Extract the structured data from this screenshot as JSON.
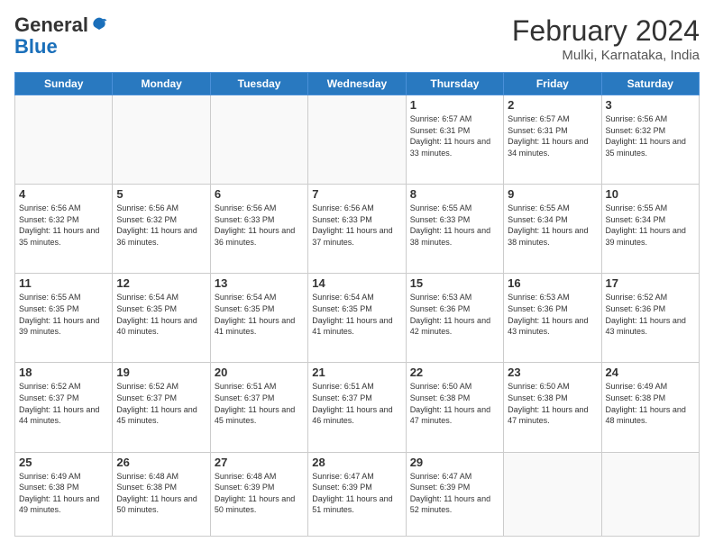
{
  "header": {
    "logo_general": "General",
    "logo_blue": "Blue",
    "title": "February 2024",
    "subtitle": "Mulki, Karnataka, India"
  },
  "days_of_week": [
    "Sunday",
    "Monday",
    "Tuesday",
    "Wednesday",
    "Thursday",
    "Friday",
    "Saturday"
  ],
  "weeks": [
    [
      {
        "num": "",
        "info": ""
      },
      {
        "num": "",
        "info": ""
      },
      {
        "num": "",
        "info": ""
      },
      {
        "num": "",
        "info": ""
      },
      {
        "num": "1",
        "info": "Sunrise: 6:57 AM\nSunset: 6:31 PM\nDaylight: 11 hours and 33 minutes."
      },
      {
        "num": "2",
        "info": "Sunrise: 6:57 AM\nSunset: 6:31 PM\nDaylight: 11 hours and 34 minutes."
      },
      {
        "num": "3",
        "info": "Sunrise: 6:56 AM\nSunset: 6:32 PM\nDaylight: 11 hours and 35 minutes."
      }
    ],
    [
      {
        "num": "4",
        "info": "Sunrise: 6:56 AM\nSunset: 6:32 PM\nDaylight: 11 hours and 35 minutes."
      },
      {
        "num": "5",
        "info": "Sunrise: 6:56 AM\nSunset: 6:32 PM\nDaylight: 11 hours and 36 minutes."
      },
      {
        "num": "6",
        "info": "Sunrise: 6:56 AM\nSunset: 6:33 PM\nDaylight: 11 hours and 36 minutes."
      },
      {
        "num": "7",
        "info": "Sunrise: 6:56 AM\nSunset: 6:33 PM\nDaylight: 11 hours and 37 minutes."
      },
      {
        "num": "8",
        "info": "Sunrise: 6:55 AM\nSunset: 6:33 PM\nDaylight: 11 hours and 38 minutes."
      },
      {
        "num": "9",
        "info": "Sunrise: 6:55 AM\nSunset: 6:34 PM\nDaylight: 11 hours and 38 minutes."
      },
      {
        "num": "10",
        "info": "Sunrise: 6:55 AM\nSunset: 6:34 PM\nDaylight: 11 hours and 39 minutes."
      }
    ],
    [
      {
        "num": "11",
        "info": "Sunrise: 6:55 AM\nSunset: 6:35 PM\nDaylight: 11 hours and 39 minutes."
      },
      {
        "num": "12",
        "info": "Sunrise: 6:54 AM\nSunset: 6:35 PM\nDaylight: 11 hours and 40 minutes."
      },
      {
        "num": "13",
        "info": "Sunrise: 6:54 AM\nSunset: 6:35 PM\nDaylight: 11 hours and 41 minutes."
      },
      {
        "num": "14",
        "info": "Sunrise: 6:54 AM\nSunset: 6:35 PM\nDaylight: 11 hours and 41 minutes."
      },
      {
        "num": "15",
        "info": "Sunrise: 6:53 AM\nSunset: 6:36 PM\nDaylight: 11 hours and 42 minutes."
      },
      {
        "num": "16",
        "info": "Sunrise: 6:53 AM\nSunset: 6:36 PM\nDaylight: 11 hours and 43 minutes."
      },
      {
        "num": "17",
        "info": "Sunrise: 6:52 AM\nSunset: 6:36 PM\nDaylight: 11 hours and 43 minutes."
      }
    ],
    [
      {
        "num": "18",
        "info": "Sunrise: 6:52 AM\nSunset: 6:37 PM\nDaylight: 11 hours and 44 minutes."
      },
      {
        "num": "19",
        "info": "Sunrise: 6:52 AM\nSunset: 6:37 PM\nDaylight: 11 hours and 45 minutes."
      },
      {
        "num": "20",
        "info": "Sunrise: 6:51 AM\nSunset: 6:37 PM\nDaylight: 11 hours and 45 minutes."
      },
      {
        "num": "21",
        "info": "Sunrise: 6:51 AM\nSunset: 6:37 PM\nDaylight: 11 hours and 46 minutes."
      },
      {
        "num": "22",
        "info": "Sunrise: 6:50 AM\nSunset: 6:38 PM\nDaylight: 11 hours and 47 minutes."
      },
      {
        "num": "23",
        "info": "Sunrise: 6:50 AM\nSunset: 6:38 PM\nDaylight: 11 hours and 47 minutes."
      },
      {
        "num": "24",
        "info": "Sunrise: 6:49 AM\nSunset: 6:38 PM\nDaylight: 11 hours and 48 minutes."
      }
    ],
    [
      {
        "num": "25",
        "info": "Sunrise: 6:49 AM\nSunset: 6:38 PM\nDaylight: 11 hours and 49 minutes."
      },
      {
        "num": "26",
        "info": "Sunrise: 6:48 AM\nSunset: 6:38 PM\nDaylight: 11 hours and 50 minutes."
      },
      {
        "num": "27",
        "info": "Sunrise: 6:48 AM\nSunset: 6:39 PM\nDaylight: 11 hours and 50 minutes."
      },
      {
        "num": "28",
        "info": "Sunrise: 6:47 AM\nSunset: 6:39 PM\nDaylight: 11 hours and 51 minutes."
      },
      {
        "num": "29",
        "info": "Sunrise: 6:47 AM\nSunset: 6:39 PM\nDaylight: 11 hours and 52 minutes."
      },
      {
        "num": "",
        "info": ""
      },
      {
        "num": "",
        "info": ""
      }
    ]
  ]
}
